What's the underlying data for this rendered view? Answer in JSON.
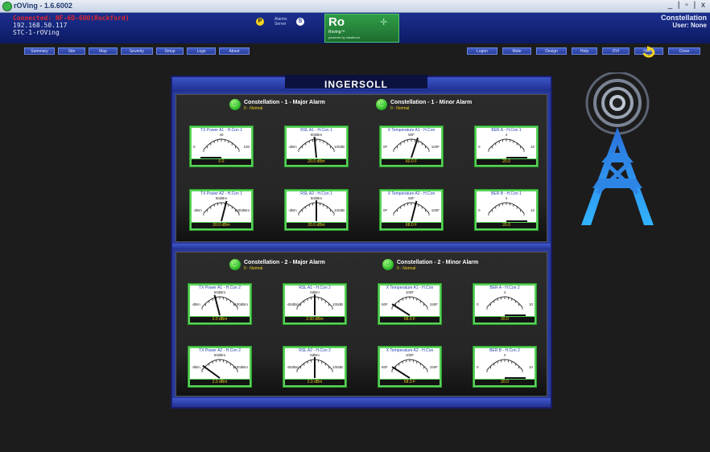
{
  "window": {
    "title": "rOVing - 1.6.6002",
    "controls": "_ | ▫ | x"
  },
  "header": {
    "connected": "Connected: NF-6D-6OO(Rockford)",
    "ip": "192.168.50.117",
    "station": "STC-1-rOVing",
    "p_badge": "P",
    "alarms_label": "Alarms",
    "server_label": "Server",
    "s_badge": "S",
    "logo_text": "Ro",
    "logo_sub": "Roving™",
    "logo_powered": "powered by stealtcom",
    "system_name": "Constellation",
    "user": "User: None"
  },
  "nav_left": [
    "Summary",
    "Site",
    "Map",
    "Severity",
    "Setup",
    "Logs",
    "About"
  ],
  "nav_right": [
    "Logon",
    "Mute",
    "Design",
    "Help",
    "DVI",
    "Home",
    "Close"
  ],
  "panel": {
    "title": "INGERSOLL"
  },
  "sections": [
    {
      "major": {
        "label": "Constellation - 1 - Major Alarm",
        "state": "0 - Normal"
      },
      "minor": {
        "label": "Constellation - 1 - Minor Alarm",
        "state": "0 - Normal"
      },
      "gauges": [
        {
          "title": "TX Power A1 - H.Con 1",
          "readout": "0.0",
          "scale_left": "0",
          "scale_mid": "40",
          "scale_right": "100",
          "level": 0.0
        },
        {
          "title": "RSL A1 - H.Con 1",
          "readout": "20.0 dBm",
          "scale_left": "-dBm",
          "scale_mid": "50dBm",
          "scale_right": "100dB",
          "level": 0.47
        },
        {
          "title": "X Temperature A1 - H.Con",
          "readout": "60.0 F",
          "scale_left": "0F",
          "scale_mid": "50F",
          "scale_right": "100F",
          "level": 0.6
        },
        {
          "title": "BER A - H.Con 1",
          "readout": "20.0",
          "scale_left": "0",
          "scale_mid": "4",
          "scale_right": "10",
          "level": 1.0
        },
        {
          "title": "TX Power A2 - H.Con 1",
          "readout": "20.0 dBm",
          "scale_left": "-dBm",
          "scale_mid": "50dBm",
          "scale_right": "100dBm",
          "level": 0.58
        },
        {
          "title": "RSL A2 - H.Con 1",
          "readout": "20.0 dBm",
          "scale_left": "-dBm",
          "scale_mid": "50dBm",
          "scale_right": "100dB",
          "level": 0.5
        },
        {
          "title": "X Temperature A2 - H.Con",
          "readout": "68.0 F",
          "scale_left": "0F",
          "scale_mid": "50F",
          "scale_right": "100F",
          "level": 0.58
        },
        {
          "title": "BER B - H.Con 1",
          "readout": "20.0",
          "scale_left": "0",
          "scale_mid": "4",
          "scale_right": "10",
          "level": 1.0
        }
      ]
    },
    {
      "major": {
        "label": "Constellation - 2 - Major Alarm",
        "state": "0 - Normal"
      },
      "minor": {
        "label": "Constellation - 2 - Minor Alarm",
        "state": "0 - Normal"
      },
      "gauges": [
        {
          "title": "TX Power A1 - H.Con 2",
          "readout": "2.0 dBm",
          "scale_left": "-dBm",
          "scale_mid": "50dBm",
          "scale_right": "100dBm",
          "level": 0.42
        },
        {
          "title": "RSL A1 - H.Con 2",
          "readout": "2.00 dBm",
          "scale_left": "-60dBm",
          "scale_mid": "0dBm",
          "scale_right": "100dB",
          "level": 0.5
        },
        {
          "title": "X Temperature A1 - H.Con",
          "readout": "68.0 F",
          "scale_left": "50F",
          "scale_mid": "100F",
          "scale_right": "150F",
          "level": 0.18
        },
        {
          "title": "BER A - H.Con 2",
          "readout": "20.0",
          "scale_left": "0",
          "scale_mid": "4",
          "scale_right": "10",
          "level": 1.0
        },
        {
          "title": "TX Power A2 - H.Con 2",
          "readout": "2.0 dBm",
          "scale_left": "-dBm",
          "scale_mid": "50dBm",
          "scale_right": "100dBm",
          "level": 0.2
        },
        {
          "title": "RSL A2 - H.Con 2",
          "readout": "2.0 dBm",
          "scale_left": "-60dBm",
          "scale_mid": "0dBm",
          "scale_right": "100dB",
          "level": 0.5
        },
        {
          "title": "X Temperature A2 - H.Con",
          "readout": "68.0 F",
          "scale_left": "50F",
          "scale_mid": "100F",
          "scale_right": "150F",
          "level": 0.18
        },
        {
          "title": "BER B - H.Con 2",
          "readout": "20.0",
          "scale_left": "0",
          "scale_mid": "4",
          "scale_right": "10",
          "level": 1.0
        }
      ]
    }
  ],
  "icons": {
    "refresh": "refresh-arrow-icon",
    "tower": "radio-tower-icon"
  },
  "colors": {
    "header": "#1b2f8e",
    "alarm_ok": "#2fbd2a",
    "gauge_frame": "#5bd25b",
    "readout": "#e9d321",
    "tower": "#2a9fe6"
  }
}
